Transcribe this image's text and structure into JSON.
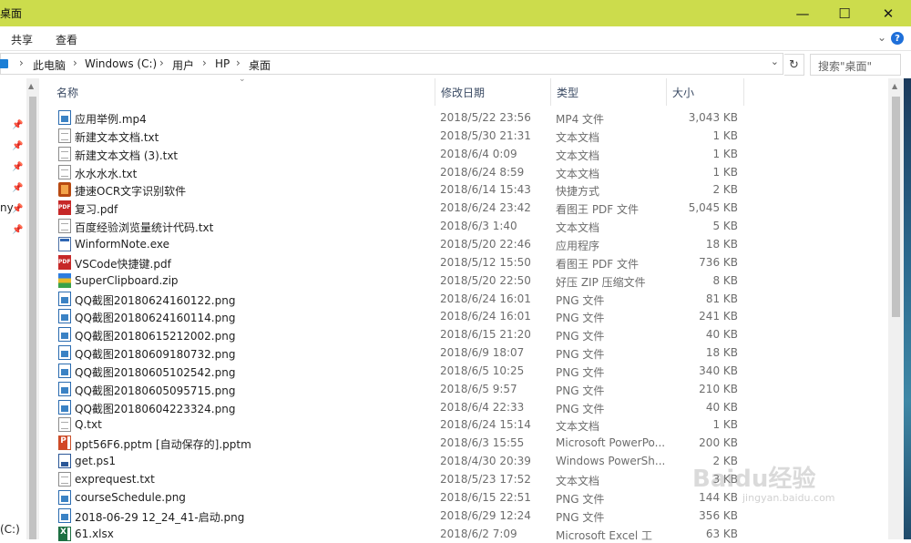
{
  "window": {
    "title": "桌面",
    "minimize_glyph": "—",
    "maximize_glyph": "☐",
    "close_glyph": "✕"
  },
  "ribbon": {
    "tabs": [
      "共享",
      "查看"
    ],
    "expand_glyph": "⌄",
    "help_glyph": "?"
  },
  "address": {
    "crumbs": [
      "此电脑",
      "Windows (C:)",
      "用户",
      "HP",
      "桌面"
    ],
    "separator": "›",
    "dropdown_glyph": "⌄",
    "refresh_glyph": "↻",
    "search_placeholder": "搜索\"桌面\""
  },
  "navpane": {
    "name_fragment": "ny",
    "drive_fragment": "(C:)"
  },
  "columns": [
    "名称",
    "修改日期",
    "类型",
    "大小"
  ],
  "files": [
    {
      "name": "应用举例.mp4",
      "date": "2018/5/22 23:56",
      "type": "MP4 文件",
      "size": "3,043 KB",
      "icon": "img"
    },
    {
      "name": "新建文本文档.txt",
      "date": "2018/5/30 21:31",
      "type": "文本文档",
      "size": "1 KB",
      "icon": "doc"
    },
    {
      "name": "新建文本文档 (3).txt",
      "date": "2018/6/4 0:09",
      "type": "文本文档",
      "size": "1 KB",
      "icon": "doc"
    },
    {
      "name": "水水水水.txt",
      "date": "2018/6/24 8:59",
      "type": "文本文档",
      "size": "1 KB",
      "icon": "doc"
    },
    {
      "name": "捷速OCR文字识别软件",
      "date": "2018/6/14 15:43",
      "type": "快捷方式",
      "size": "2 KB",
      "icon": "lnk"
    },
    {
      "name": "复习.pdf",
      "date": "2018/6/24 23:42",
      "type": "看图王 PDF 文件",
      "size": "5,045 KB",
      "icon": "pdf"
    },
    {
      "name": "百度经验浏览量统计代码.txt",
      "date": "2018/6/3 1:40",
      "type": "文本文档",
      "size": "5 KB",
      "icon": "doc"
    },
    {
      "name": "WinformNote.exe",
      "date": "2018/5/20 22:46",
      "type": "应用程序",
      "size": "18 KB",
      "icon": "exe"
    },
    {
      "name": "VSCode快捷键.pdf",
      "date": "2018/5/12 15:50",
      "type": "看图王 PDF 文件",
      "size": "736 KB",
      "icon": "pdf"
    },
    {
      "name": "SuperClipboard.zip",
      "date": "2018/5/20 22:50",
      "type": "好压 ZIP 压缩文件",
      "size": "8 KB",
      "icon": "zip"
    },
    {
      "name": "QQ截图20180624160122.png",
      "date": "2018/6/24 16:01",
      "type": "PNG 文件",
      "size": "81 KB",
      "icon": "img"
    },
    {
      "name": "QQ截图20180624160114.png",
      "date": "2018/6/24 16:01",
      "type": "PNG 文件",
      "size": "241 KB",
      "icon": "img"
    },
    {
      "name": "QQ截图20180615212002.png",
      "date": "2018/6/15 21:20",
      "type": "PNG 文件",
      "size": "40 KB",
      "icon": "img"
    },
    {
      "name": "QQ截图20180609180732.png",
      "date": "2018/6/9 18:07",
      "type": "PNG 文件",
      "size": "18 KB",
      "icon": "img"
    },
    {
      "name": "QQ截图20180605102542.png",
      "date": "2018/6/5 10:25",
      "type": "PNG 文件",
      "size": "340 KB",
      "icon": "img"
    },
    {
      "name": "QQ截图20180605095715.png",
      "date": "2018/6/5 9:57",
      "type": "PNG 文件",
      "size": "210 KB",
      "icon": "img"
    },
    {
      "name": "QQ截图20180604223324.png",
      "date": "2018/6/4 22:33",
      "type": "PNG 文件",
      "size": "40 KB",
      "icon": "img"
    },
    {
      "name": "Q.txt",
      "date": "2018/6/24 15:14",
      "type": "文本文档",
      "size": "1 KB",
      "icon": "doc"
    },
    {
      "name": "ppt56F6.pptm [自动保存的].pptm",
      "date": "2018/6/3 15:55",
      "type": "Microsoft PowerPo...",
      "size": "200 KB",
      "icon": "ppt"
    },
    {
      "name": "get.ps1",
      "date": "2018/4/30 20:39",
      "type": "Windows PowerSh...",
      "size": "2 KB",
      "icon": "ps"
    },
    {
      "name": "exprequest.txt",
      "date": "2018/5/23 17:52",
      "type": "文本文档",
      "size": "3 KB",
      "icon": "doc"
    },
    {
      "name": "courseSchedule.png",
      "date": "2018/6/15 22:51",
      "type": "PNG 文件",
      "size": "144 KB",
      "icon": "img"
    },
    {
      "name": "2018-06-29 12_24_41-启动.png",
      "date": "2018/6/29 12:24",
      "type": "PNG 文件",
      "size": "356 KB",
      "icon": "img"
    },
    {
      "name": "61.xlsx",
      "date": "2018/6/2 7:09",
      "type": "Microsoft Excel 工",
      "size": "63 KB",
      "icon": "xls"
    }
  ],
  "watermark": {
    "brand": "Baidu经验",
    "url": "jingyan.baidu.com"
  }
}
